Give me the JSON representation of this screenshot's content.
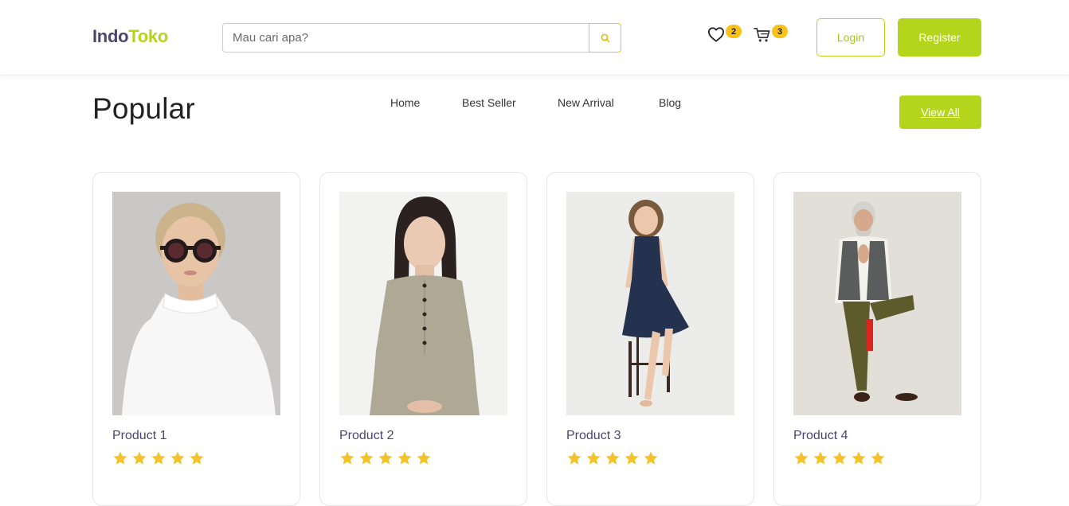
{
  "brand": {
    "part1": "Indo",
    "part2": "Toko"
  },
  "search": {
    "placeholder": "Mau cari apa?"
  },
  "header": {
    "wishlist_count": "2",
    "cart_count": "3",
    "login_label": "Login",
    "register_label": "Register"
  },
  "section": {
    "title": "Popular",
    "nav": [
      "Home",
      "Best Seller",
      "New Arrival",
      "Blog"
    ],
    "view_all_label": "View All"
  },
  "products": [
    {
      "name": "Product 1",
      "rating": 5
    },
    {
      "name": "Product 2",
      "rating": 5
    },
    {
      "name": "Product 3",
      "rating": 5
    },
    {
      "name": "Product 4",
      "rating": 5
    }
  ],
  "colors": {
    "accent": "#b5d51c",
    "brand_dark": "#4a4571",
    "badge": "#f8c21a",
    "star": "#f4c22b"
  }
}
